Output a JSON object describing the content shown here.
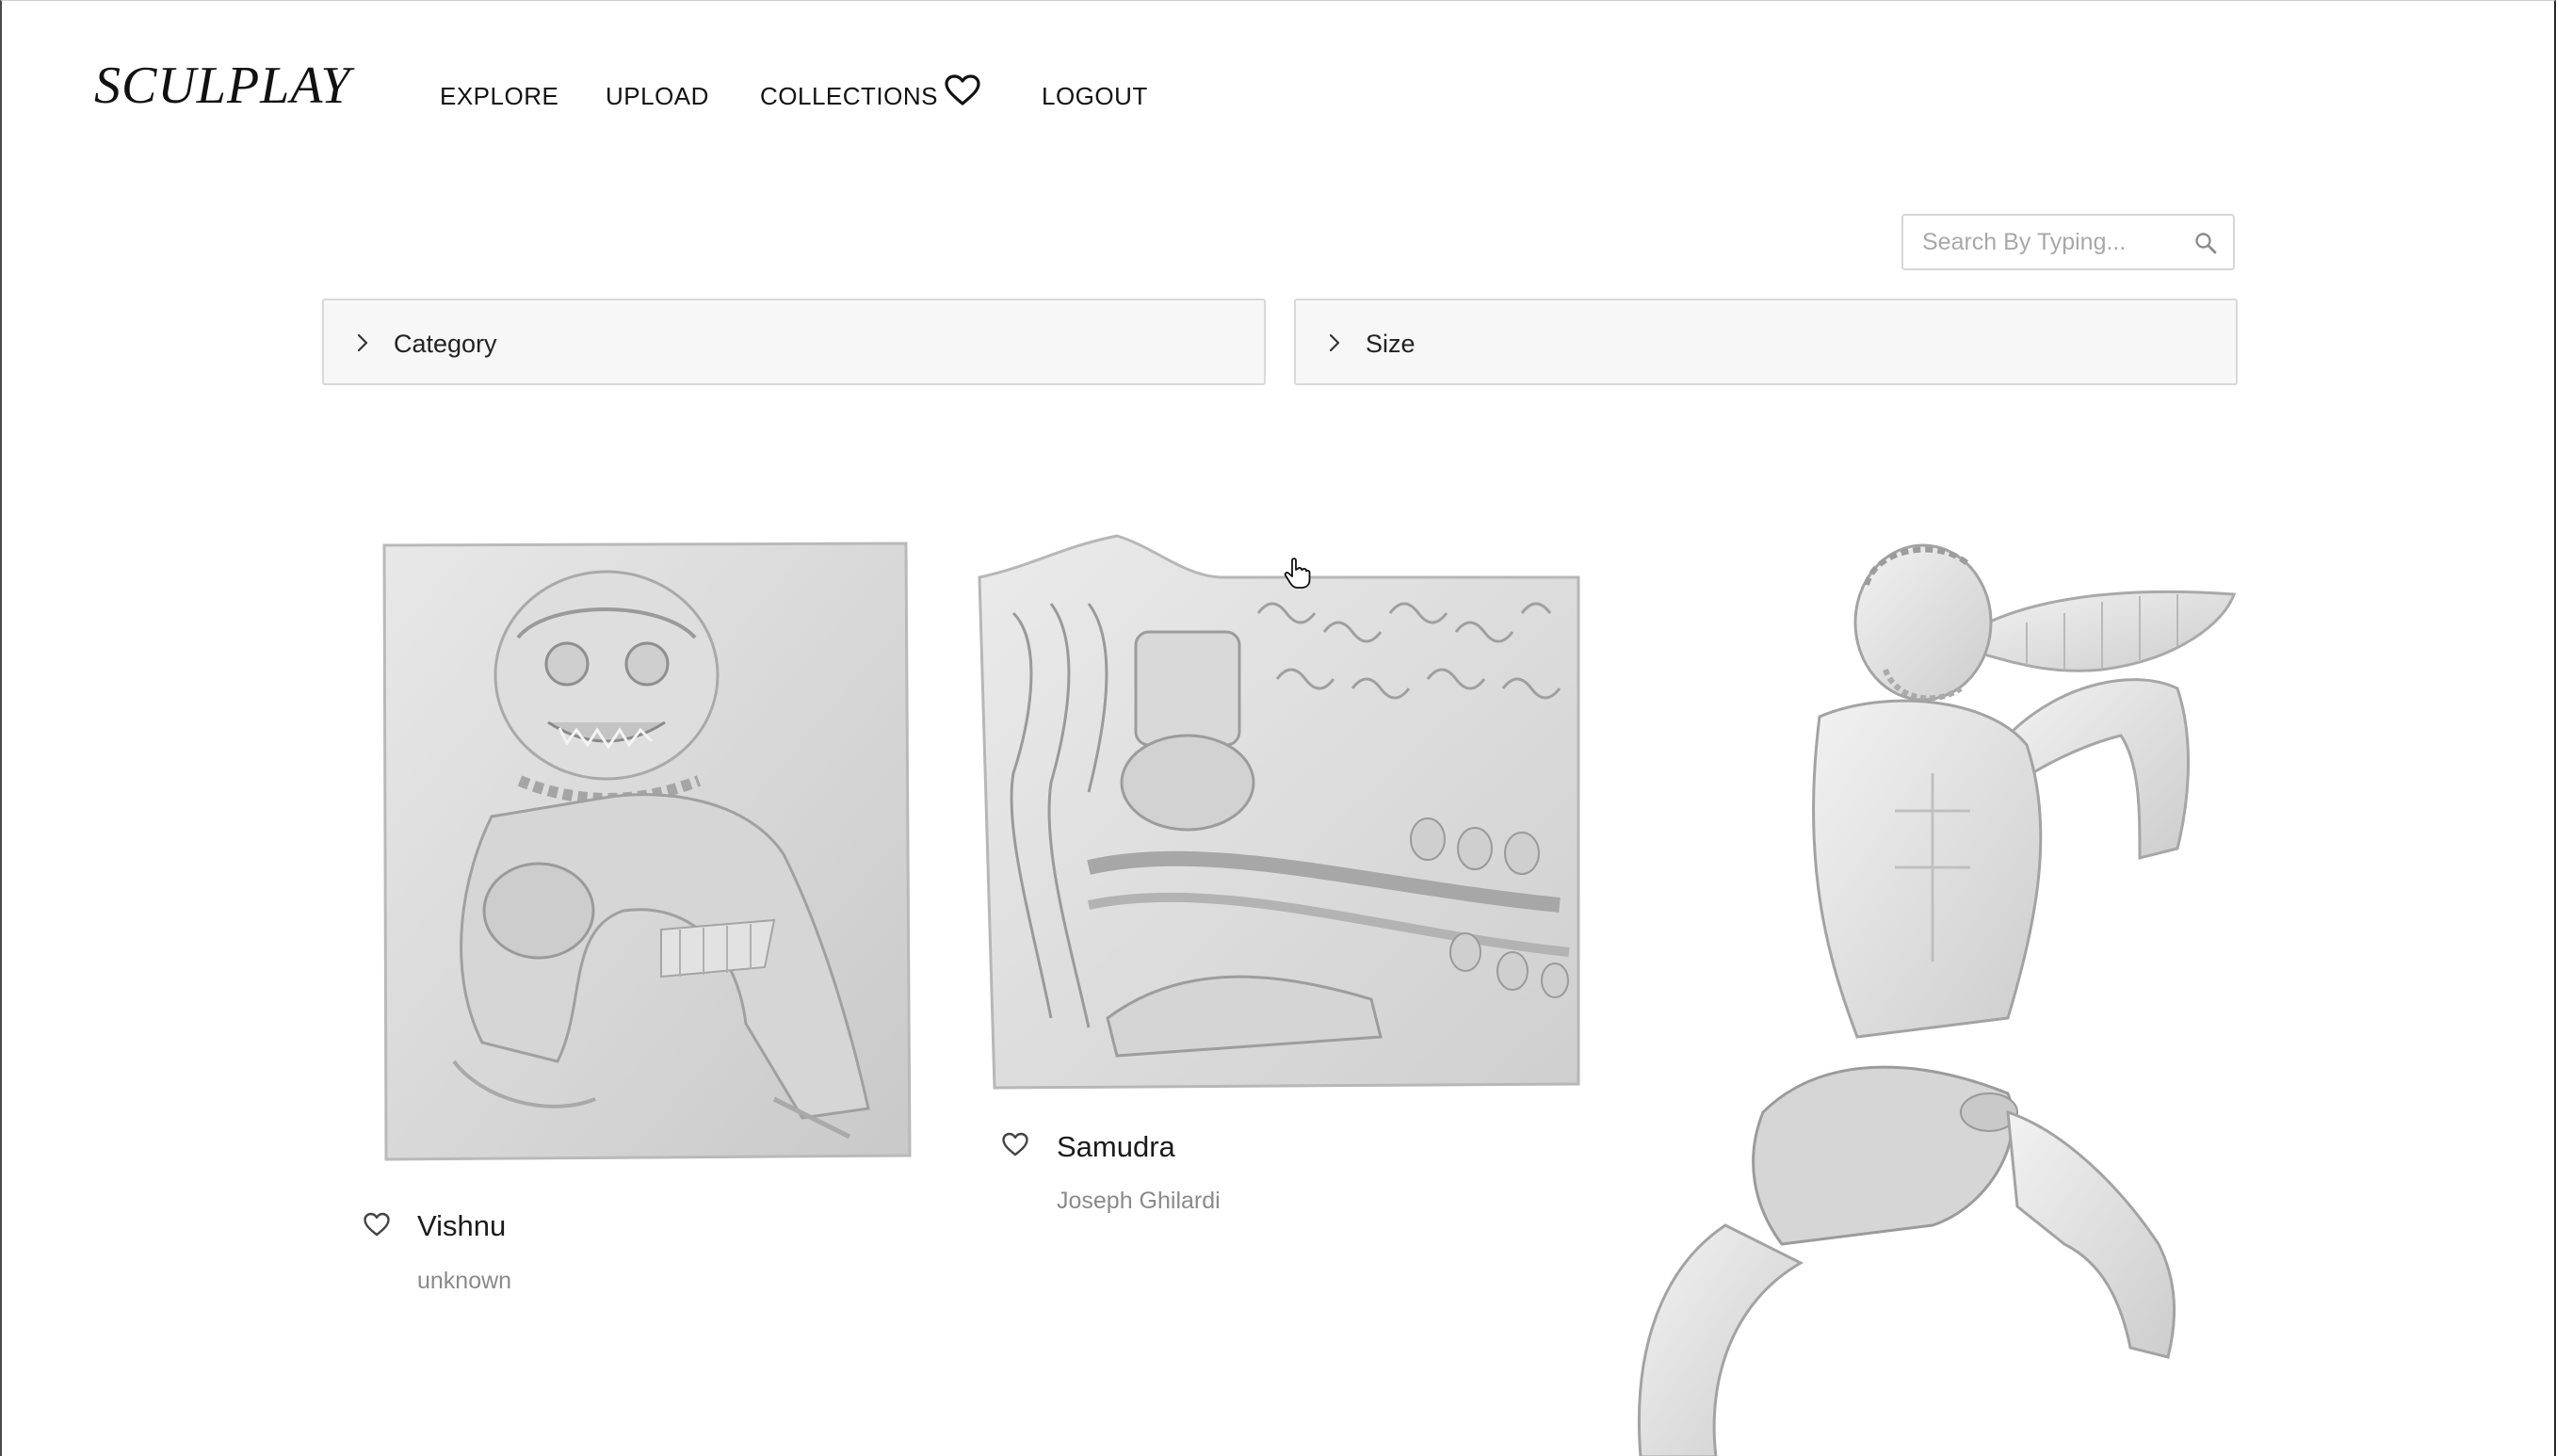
{
  "header": {
    "brand": "SCULPLAY",
    "nav": {
      "explore": "EXPLORE",
      "upload": "UPLOAD",
      "collections": "COLLECTIONS",
      "logout": "LOGOUT"
    },
    "collections_icon": "heart-outline-icon"
  },
  "search": {
    "placeholder": "Search By Typing...",
    "value": "",
    "icon": "magnifier-icon"
  },
  "filters": {
    "category": {
      "label": "Category",
      "expanded": false,
      "icon": "chevron-right-icon"
    },
    "size": {
      "label": "Size",
      "expanded": false,
      "icon": "chevron-right-icon"
    }
  },
  "gallery": {
    "items": [
      {
        "title": "Vishnu",
        "artist": "unknown",
        "favorited": false,
        "image": "relief of a fierce guardian figure"
      },
      {
        "title": "Samudra",
        "artist": "Joseph Ghilardi",
        "favorited": false,
        "image": "bas-relief of a churning scene with many figures"
      },
      {
        "title": "",
        "artist": "",
        "favorited": false,
        "image": "marble triton blowing a conch shell"
      }
    ]
  },
  "colors": {
    "background": "#ffffff",
    "text": "#1a1a1a",
    "muted_text": "#8a8a8a",
    "filter_bg": "#f7f7f7",
    "border": "#d9d9d9",
    "sculpture_gray": "#d8d8d8"
  }
}
